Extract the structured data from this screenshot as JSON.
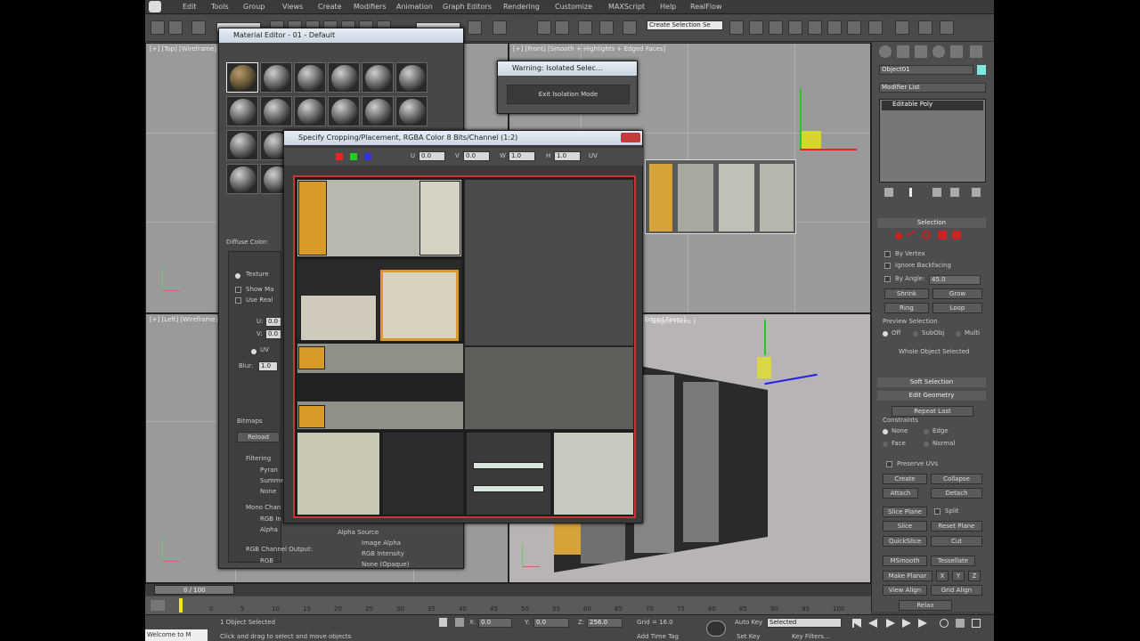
{
  "menu": [
    "Edit",
    "Tools",
    "Group",
    "Views",
    "Create",
    "Modifiers",
    "Animation",
    "Graph Editors",
    "Rendering",
    "Customize",
    "MAXScript",
    "Help",
    "RealFlow"
  ],
  "toolbar": {
    "selection_set": "Create Selection Se"
  },
  "viewports": {
    "top_left": "[+] [Top] [Wireframe]",
    "top_right": "[+] [Front] [Smooth + Highlights + Edged Faces]",
    "bottom_left": "[+] [Left] [Wireframe]",
    "bottom_right": "[+] [Perspective] [Smooth + Highlights + Edged Faces]",
    "edged_faces": "Edged Faces ]"
  },
  "isolate": {
    "title": "Warning: Isolated Selec...",
    "button": "Exit Isolation Mode"
  },
  "material_editor": {
    "title": "Material Editor - 01 - Default",
    "diffuse_label": "Diffuse Color:",
    "texture": "Texture",
    "show_map": "Show Ma",
    "use_real": "Use Real",
    "u_label": "U:",
    "v_label": "V:",
    "u_value": "0.0",
    "v_value": "0.0",
    "uv": "UV",
    "blur_label": "Blur:",
    "blur_value": "1.0",
    "bitmaps": "Bitmaps",
    "reload": "Reload",
    "filtering": "Filtering",
    "pyramidal": "Pyran",
    "summed": "Summe",
    "none": "None",
    "mono_channel": "Mono Chan",
    "rgb_intensity": "RGB In",
    "alpha": "Alpha",
    "rgb_output": "RGB Channel Output:",
    "rgb": "RGB",
    "alpha_source": "Alpha Source",
    "image_alpha": "Image Alpha",
    "rgb_intensity_full": "RGB Intensity",
    "none_opaque": "None (Opaque)"
  },
  "crop": {
    "title": "Specify Cropping/Placement, RGBA Color 8 Bits/Channel (1:2)",
    "u_label": "U",
    "u_value": "0.0",
    "v_label": "V",
    "v_value": "0.0",
    "w_label": "W",
    "w_value": "1.0",
    "h_label": "H",
    "h_value": "1.0",
    "uv": "UV"
  },
  "command_panel": {
    "object_name": "Object01",
    "modifier_list": "Modifier List",
    "stack_item": "Editable Poly",
    "selection": "Selection",
    "by_vertex": "By Vertex",
    "ignore_backfacing": "Ignore Backfacing",
    "by_angle": "By Angle:",
    "angle_value": "45.0",
    "shrink": "Shrink",
    "grow": "Grow",
    "ring": "Ring",
    "loop": "Loop",
    "preview_selection": "Preview Selection",
    "off": "Off",
    "subobj": "SubObj",
    "multi": "Multi",
    "whole_object": "Whole Object Selected",
    "soft_selection": "Soft Selection",
    "edit_geometry": "Edit Geometry",
    "repeat_last": "Repeat Last",
    "constraints": "Constraints",
    "c_none": "None",
    "c_edge": "Edge",
    "c_face": "Face",
    "c_normal": "Normal",
    "preserve_uvs": "Preserve UVs",
    "create": "Create",
    "collapse": "Collapse",
    "attach": "Attach",
    "detach": "Detach",
    "slice_plane": "Slice Plane",
    "split": "Split",
    "slice": "Slice",
    "reset_plane": "Reset Plane",
    "quickslice": "QuickSlice",
    "cut": "Cut",
    "msmooth": "MSmooth",
    "tessellate": "Tessellate",
    "make_planar": "Make Planar",
    "x": "X",
    "y": "Y",
    "z": "Z",
    "view_align": "View Align",
    "grid_align": "Grid Align",
    "relax": "Relax"
  },
  "timeline": {
    "frame": "0 / 100",
    "ticks": [
      "0",
      "5",
      "10",
      "15",
      "20",
      "25",
      "30",
      "35",
      "40",
      "45",
      "50",
      "55",
      "60",
      "65",
      "70",
      "75",
      "80",
      "85",
      "90",
      "95",
      "100"
    ]
  },
  "status": {
    "selected": "1 Object Selected",
    "prompt": "Click and drag to select and move objects",
    "welcome": "Welcome to M",
    "x_label": "X:",
    "x_value": "0.0",
    "y_label": "Y:",
    "y_value": "0.0",
    "z_label": "Z:",
    "z_value": "256.0",
    "grid": "Grid = 16.0",
    "add_time_tag": "Add Time Tag",
    "auto_key": "Auto Key",
    "selected_mode": "Selected",
    "set_key": "Set Key",
    "key_filters": "Key Filters..."
  }
}
